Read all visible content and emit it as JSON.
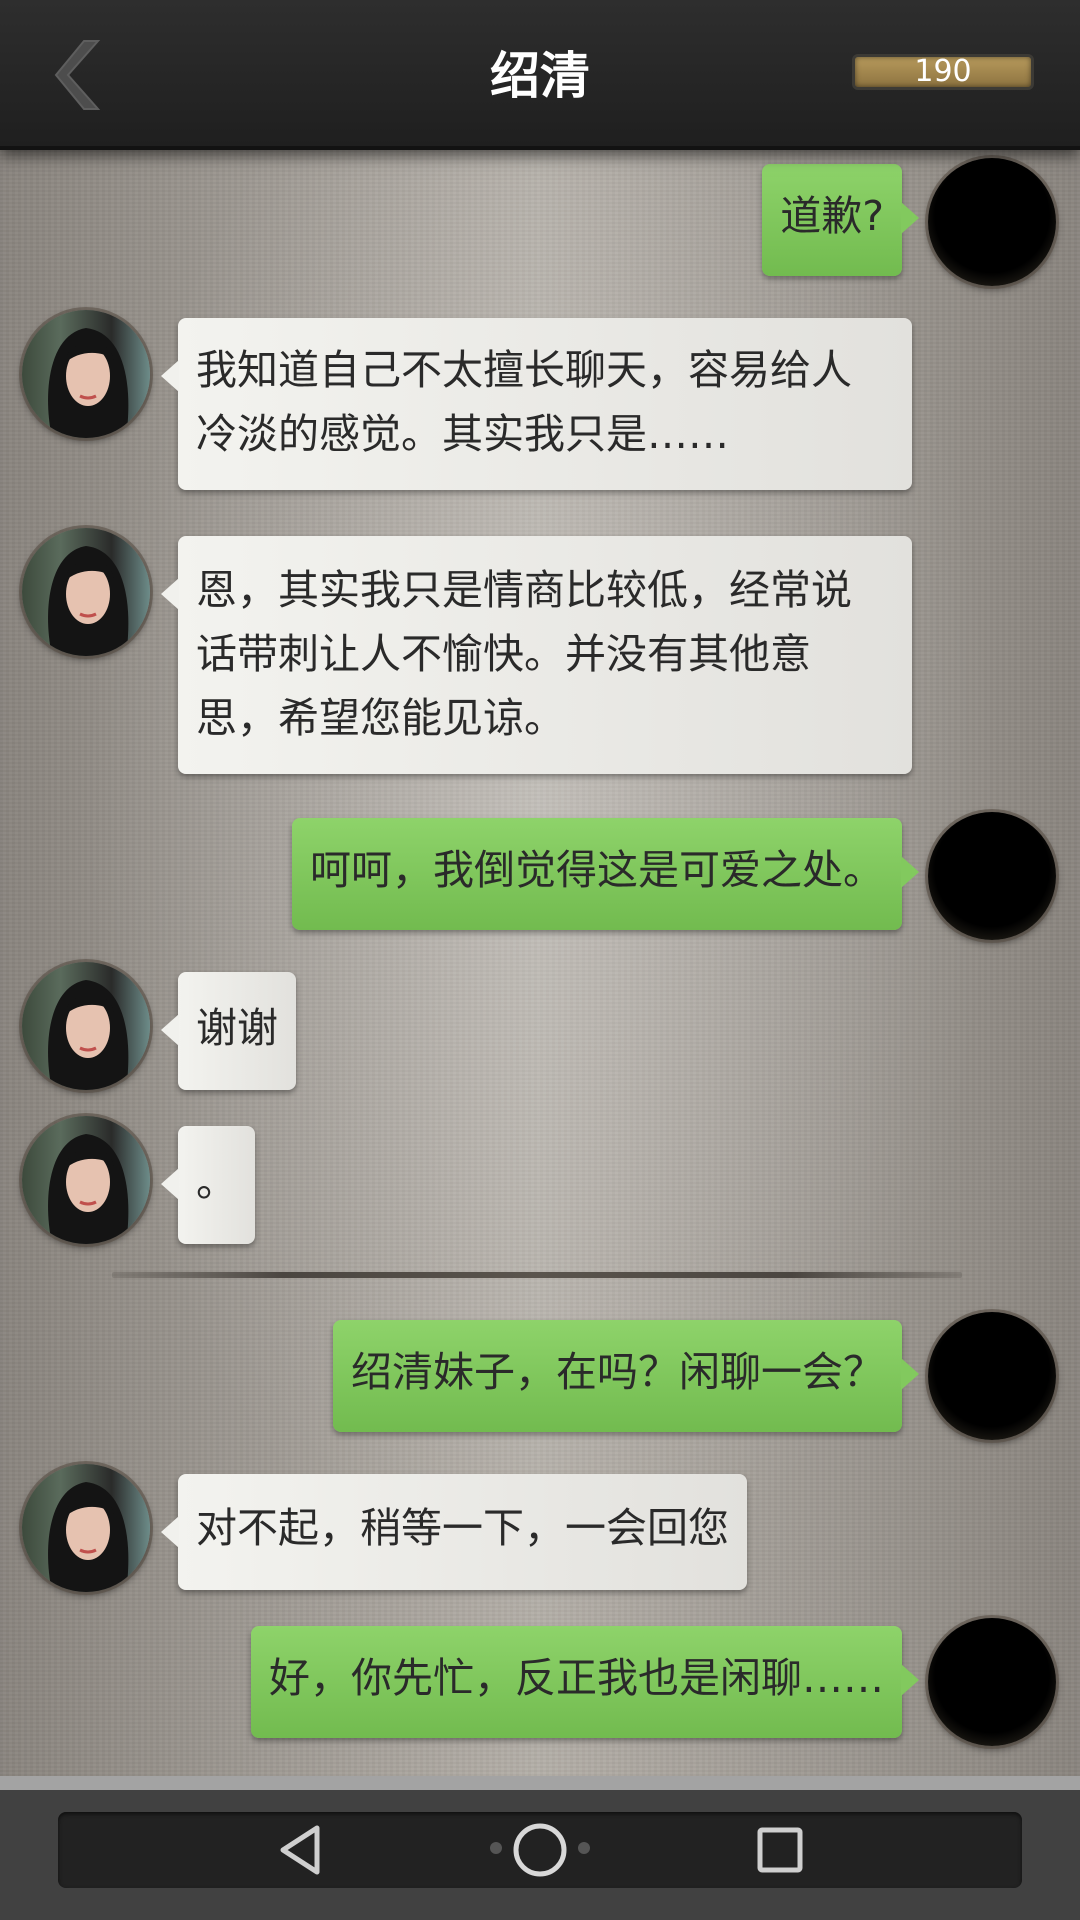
{
  "header": {
    "title": "绍清",
    "score": "190"
  },
  "messages": [
    {
      "sender": "me",
      "lines": [
        "道歉?"
      ]
    },
    {
      "sender": "her",
      "lines": [
        "我知道自己不太擅长聊天，容易给人",
        "冷淡的感觉。其实我只是……"
      ]
    },
    {
      "sender": "her",
      "lines": [
        "恩，其实我只是情商比较低，经常说",
        "话带刺让人不愉快。并没有其他意",
        "思，希望您能见谅。"
      ]
    },
    {
      "sender": "me",
      "lines": [
        "呵呵，我倒觉得这是可爱之处。"
      ]
    },
    {
      "sender": "her",
      "lines": [
        "谢谢"
      ]
    },
    {
      "sender": "her",
      "lines": [
        "。"
      ]
    },
    {
      "sender": "me",
      "lines": [
        "绍清妹子，在吗？闲聊一会？"
      ]
    },
    {
      "sender": "her",
      "lines": [
        "对不起，稍等一下，一会回您"
      ]
    },
    {
      "sender": "me",
      "lines": [
        "好，你先忙，反正我也是闲聊……"
      ]
    }
  ],
  "icons": {
    "back": "chevron-left-icon",
    "nav_back": "triangle-back-icon",
    "nav_home": "circle-home-icon",
    "nav_recent": "square-recent-icon"
  },
  "colors": {
    "my_bubble": "#7fc75a",
    "her_bubble": "#eeeeea",
    "header": "#262626"
  }
}
